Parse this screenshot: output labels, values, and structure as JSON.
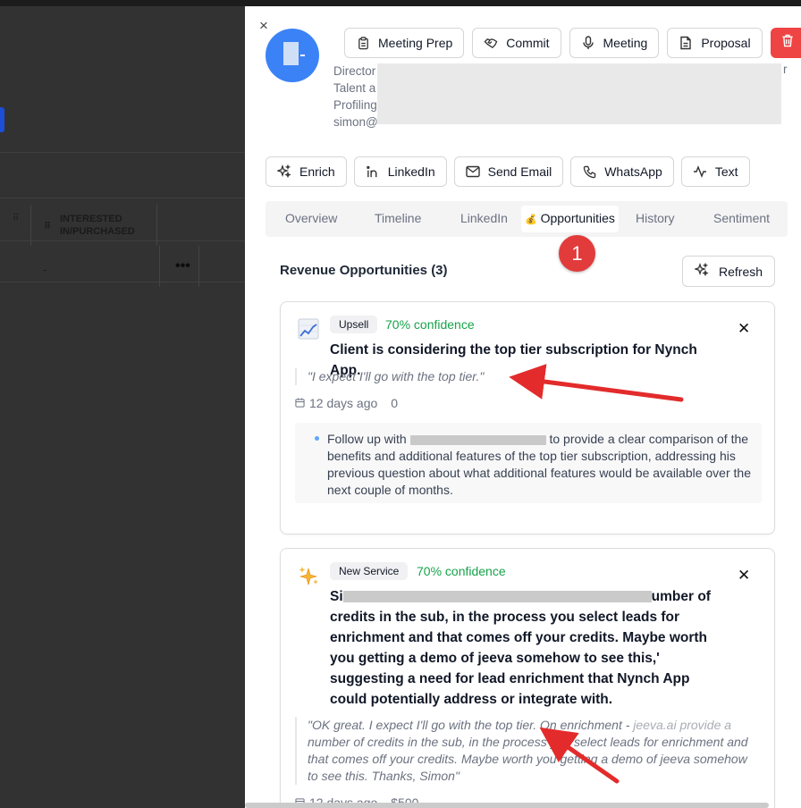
{
  "background": {
    "table_header": "INTERESTED\nIN/PURCHASED",
    "cell_value": "-",
    "row_menu": "•••"
  },
  "panel": {
    "close": "×",
    "contact_lines": [
      "Director",
      "Talent a",
      "Profiling",
      "simon@"
    ],
    "contact_tail": "r",
    "top_actions": [
      {
        "label": "Meeting Prep",
        "icon": "clipboard-icon"
      },
      {
        "label": "Commit",
        "icon": "handshake-icon"
      },
      {
        "label": "Meeting",
        "icon": "microphone-icon"
      },
      {
        "label": "Proposal",
        "icon": "document-icon"
      }
    ],
    "delete_icon": "trash-icon",
    "secondary_actions": [
      {
        "label": "Enrich",
        "icon": "sparkles-icon"
      },
      {
        "label": "LinkedIn",
        "icon": "linkedin-icon"
      },
      {
        "label": "Send Email",
        "icon": "mail-icon"
      },
      {
        "label": "WhatsApp",
        "icon": "phone-icon"
      },
      {
        "label": "Text",
        "icon": "activity-icon"
      }
    ],
    "tabs": [
      {
        "label": "Overview"
      },
      {
        "label": "Timeline"
      },
      {
        "label": "LinkedIn"
      },
      {
        "label": "Opportunities",
        "emoji": "💰",
        "active": true
      },
      {
        "label": "History"
      },
      {
        "label": "Sentiment"
      }
    ],
    "step_badge": "1",
    "section_title": "Revenue Opportunities (3)",
    "refresh_label": "Refresh",
    "opportunities": [
      {
        "tag": "Upsell",
        "confidence": "70% confidence",
        "title": "Client is considering the top tier subscription for Nynch App.",
        "quote": "\"I expect I'll go with the top tier.\"",
        "age": "12 days ago",
        "value": "0",
        "suggestion_pre": "Follow up with",
        "suggestion_post": "to provide a clear comparison of the benefits and additional features of the top tier subscription, addressing his previous question about what additional features would be available over the next couple of months."
      },
      {
        "tag": "New Service",
        "confidence": "70% confidence",
        "title_start": "Si",
        "title_tail": "umber of",
        "title_rest": "credits in the sub, in the process you select leads for enrichment and that comes off your credits. Maybe worth you getting a demo of jeeva somehow to see this,' suggesting a need for lead enrichment that Nynch App could potentially address or integrate with.",
        "quote_pre": "\"OK great. I expect I'll go with the top tier. On enrichment -",
        "quote_mid": "jeeva.ai provide a",
        "quote_post": "number of credits in the sub, in the process you select leads for enrichment and that comes off your credits. Maybe worth you getting a demo of jeeva somehow to see this. Thanks, Simon\"",
        "age": "12 days ago",
        "value": "$500"
      }
    ]
  },
  "colors": {
    "accent_red": "#ef4444",
    "badge_red": "#e23b3b",
    "confidence_green": "#16a34a",
    "avatar_blue": "#3b82f6",
    "arrow_red": "#e32b2b"
  }
}
